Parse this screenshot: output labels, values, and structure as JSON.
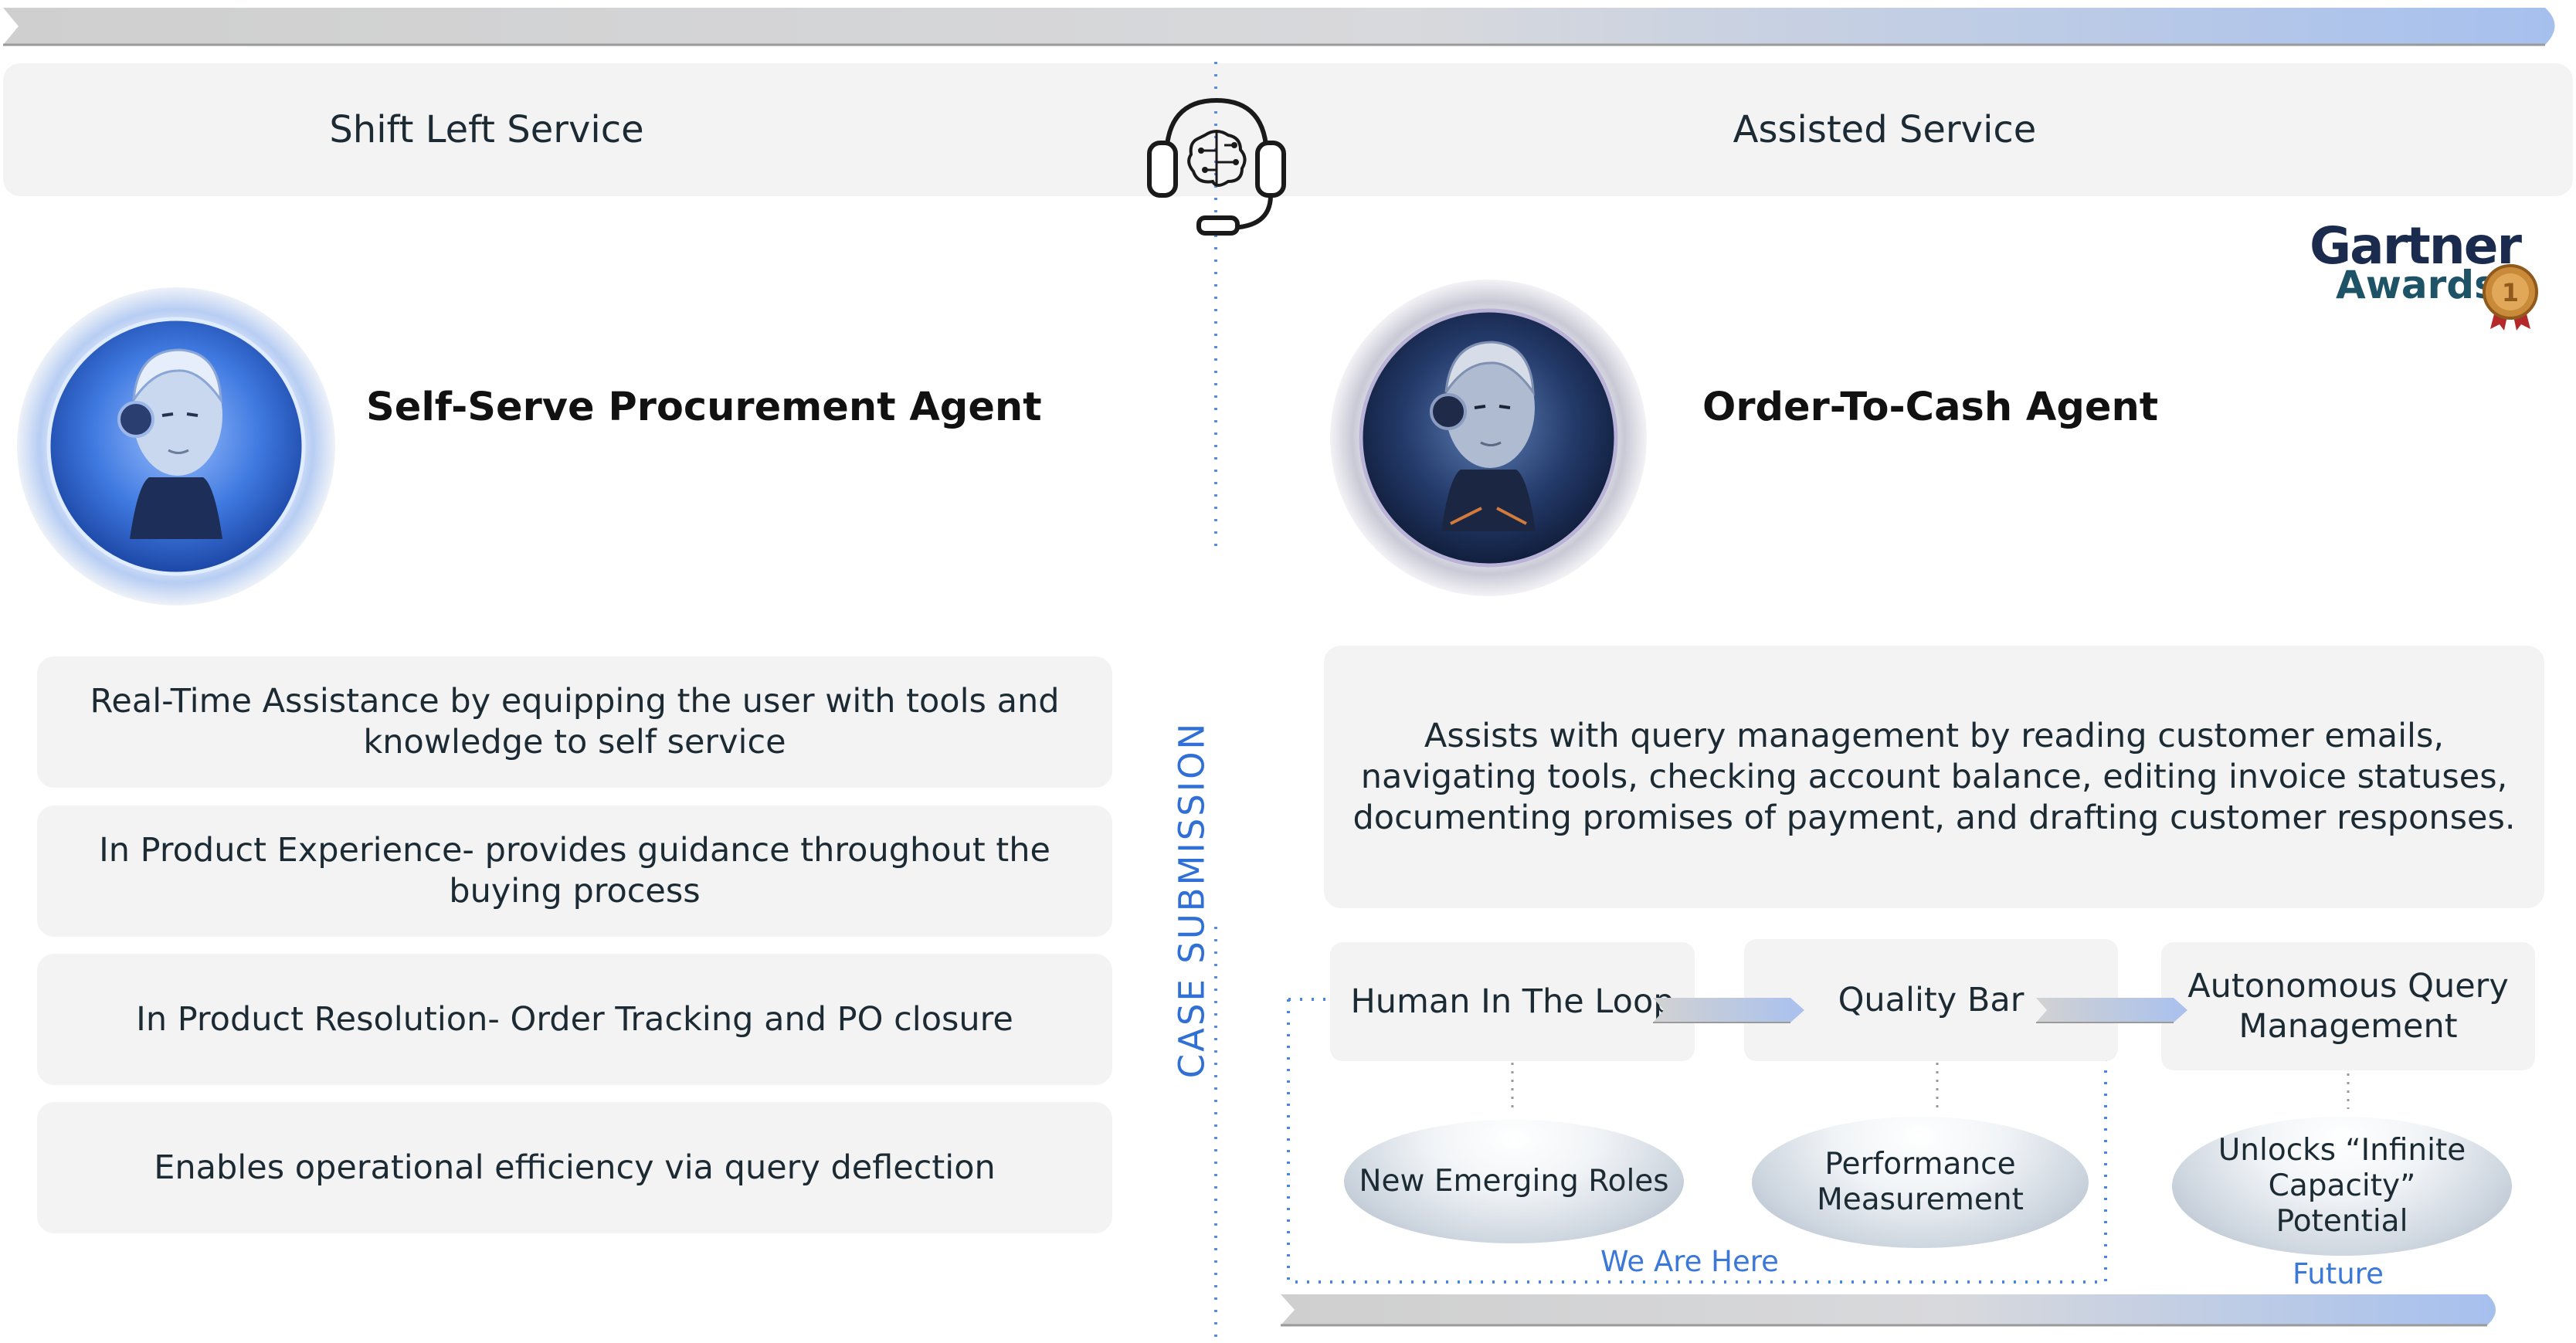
{
  "header": {
    "left_label": "Shift Left Service",
    "right_label": "Assisted Service"
  },
  "divider_label": "CASE SUBMISSION",
  "badge": {
    "line1": "Gartner",
    "line2": "Awards",
    "medal_number": "1"
  },
  "left": {
    "agent_title": "Self-Serve Procurement Agent",
    "features": [
      "Real-Time Assistance by equipping the user with tools and knowledge to self service",
      "In Product Experience- provides guidance throughout the buying process",
      "In Product Resolution- Order Tracking and PO closure",
      "Enables operational efficiency via query deflection"
    ]
  },
  "right": {
    "agent_title": "Order-To-Cash Agent",
    "description": "Assists with query management by reading customer emails, navigating tools, checking account balance, editing invoice statuses, documenting promises of payment, and drafting customer responses.",
    "stages": [
      {
        "label": "Human In The Loop",
        "outcome": "New Emerging Roles"
      },
      {
        "label": "Quality Bar",
        "outcome": "Performance Measurement"
      },
      {
        "label": "Autonomous Query Management",
        "outcome": "Unlocks “Infinite Capacity” Potential"
      }
    ],
    "current_marker": "We Are Here",
    "future_marker": "Future"
  },
  "icons": {
    "headset": "headset-brain-icon",
    "left_avatar": "robot-avatar-blue",
    "right_avatar": "robot-avatar-dark",
    "medal": "medal-icon"
  },
  "colors": {
    "panel": "#f3f3f4",
    "accent_blue": "#3c78d8",
    "arrow_gray": "#c8c8c8",
    "arrow_blue": "#a9c1ee"
  }
}
